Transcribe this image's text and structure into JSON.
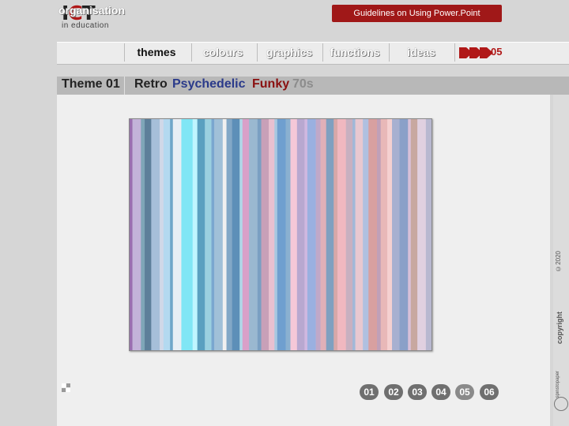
{
  "header": {
    "logo_main": "I",
    "logo_accent": "C",
    "logo_tail": "T",
    "logo_sub": "in education",
    "guidelines_label": "Guidelines on Using Power.Point"
  },
  "nav": {
    "items": [
      {
        "label": "organisation",
        "active": false
      },
      {
        "label": "themes",
        "active": true
      },
      {
        "label": "colours",
        "active": false
      },
      {
        "label": "graphics",
        "active": false
      },
      {
        "label": "functions",
        "active": false
      },
      {
        "label": "ideas",
        "active": false
      }
    ],
    "page_number": "05"
  },
  "theme": {
    "title": "Theme 01",
    "tabs": [
      {
        "label": "Retro",
        "color": "#222222"
      },
      {
        "label": "Psychedelic",
        "color": "#2a3a8a"
      },
      {
        "label": "Funky",
        "color": "#8a1010"
      },
      {
        "label": "70s",
        "color": "#8c8c8c"
      }
    ]
  },
  "stripes": {
    "colors": [
      "#9a6fb0",
      "#c3b3d9",
      "#7fa6b8",
      "#5d7f9a",
      "#a6bfd9",
      "#d0d8e8",
      "#b3d9f0",
      "#6fa6c9",
      "#e8eef5",
      "#80e6f5",
      "#bff5ff",
      "#5aa0c0",
      "#9ad0e0",
      "#7aa7cf",
      "#a0c0d8",
      "#f0f0f0",
      "#82a8c7",
      "#5d8fb8",
      "#b0d8e8",
      "#d9a0c8",
      "#9ab8d0",
      "#7a9fc2",
      "#c8a0b8",
      "#e8c0d0",
      "#a8c8e0",
      "#6f9fcf",
      "#8ab0d0",
      "#f5c8d8",
      "#b8a8d0",
      "#d0b8e0",
      "#9ab0e0",
      "#c0a8c8",
      "#e0b0b8",
      "#7fa0c0",
      "#d8a8a8",
      "#f0b8c0",
      "#c8b0c0",
      "#a0b8d8",
      "#e8c8d0",
      "#b0c0e0",
      "#d8a0a0",
      "#c0a0b8",
      "#e8b8b8",
      "#f5d0d0",
      "#a8b0d0",
      "#8aa0c8",
      "#d8c0d8",
      "#c8a8a0",
      "#e0d0e0",
      "#b8b8d0"
    ],
    "widths": [
      3,
      9,
      4,
      7,
      9,
      4,
      7,
      3,
      9,
      12,
      5,
      8,
      7,
      3,
      9,
      4,
      6,
      8,
      3,
      7,
      9,
      4,
      8,
      6,
      3,
      9,
      5,
      7,
      8,
      3,
      9,
      5,
      6,
      8,
      4,
      9,
      7,
      3,
      8,
      6,
      9,
      4,
      7,
      5,
      8,
      9,
      3,
      7,
      9,
      6
    ]
  },
  "pager": {
    "pages": [
      "01",
      "02",
      "03",
      "04",
      "05",
      "06"
    ],
    "current_index": 4
  },
  "side": {
    "label_1": "©2020",
    "label_2": "copyright",
    "label_3": "spinstopaper"
  }
}
